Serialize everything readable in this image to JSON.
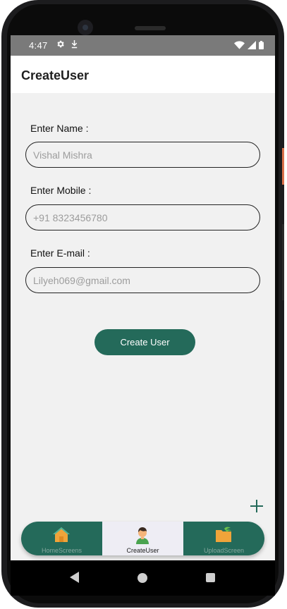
{
  "status": {
    "time": "4:47",
    "icons_left": [
      "gear-icon",
      "download-icon"
    ],
    "icons_right": [
      "wifi-icon",
      "signal-icon",
      "battery-icon"
    ]
  },
  "appbar": {
    "title": "CreateUser"
  },
  "form": {
    "name_label": "Enter Name :",
    "name_value": "Vishal Mishra",
    "mobile_label": "Enter Mobile :",
    "mobile_value": "+91 8323456780",
    "email_label": "Enter E-mail :",
    "email_value": "Lilyeh069@gmail.com",
    "submit_label": "Create User"
  },
  "fab_icon": "plus-icon",
  "bottom_nav": {
    "items": [
      {
        "label": "HomeScreens",
        "icon": "home-icon",
        "active": false
      },
      {
        "label": "CreateUser",
        "icon": "user-avatar-icon",
        "active": true
      },
      {
        "label": "UploadScreen",
        "icon": "upload-folder-icon",
        "active": false
      }
    ]
  },
  "colors": {
    "accent": "#246a5a",
    "background": "#f1f1f1",
    "status_bar": "#7a7a7a",
    "active_tab": "#eeedf4"
  }
}
